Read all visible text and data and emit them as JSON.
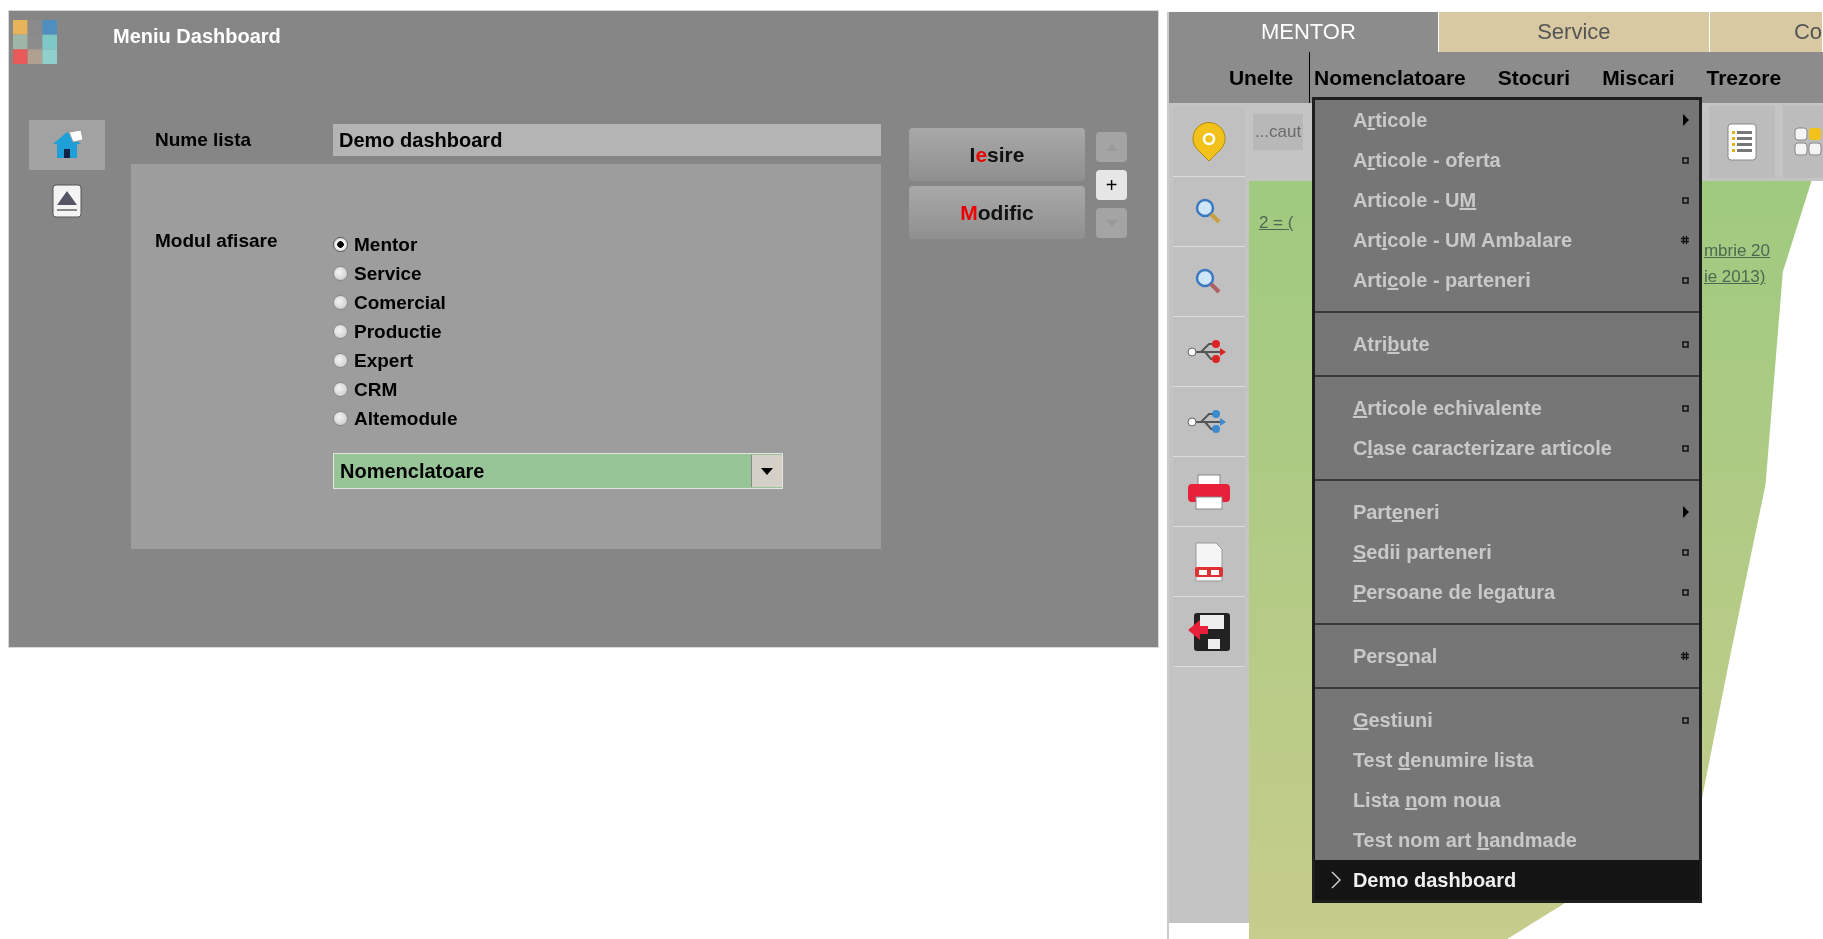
{
  "window": {
    "title": "Meniu Dashboard"
  },
  "sidebar": [
    {
      "kind": "home",
      "selected": true
    },
    {
      "kind": "edit",
      "selected": false
    }
  ],
  "form": {
    "name_label": "Nume lista",
    "name_value": "Demo dashboard",
    "mode_label": "Modul  afisare",
    "modes": [
      {
        "label": "Mentor",
        "selected": true
      },
      {
        "label": "Service",
        "selected": false
      },
      {
        "label": "Comercial",
        "selected": false
      },
      {
        "label": "Productie",
        "selected": false
      },
      {
        "label": "Expert",
        "selected": false
      },
      {
        "label": "CRM",
        "selected": false
      },
      {
        "label": "Altemodule",
        "selected": false
      }
    ],
    "dropdown_value": "Nomenclatoare"
  },
  "buttons": [
    {
      "before": "I",
      "hotkey": "e",
      "after": "sire"
    },
    {
      "hotkey": "M",
      "after": "odific"
    }
  ],
  "spinner": {
    "plus": "+"
  },
  "app": {
    "tabs": [
      {
        "label": "MENTOR",
        "selected": true
      },
      {
        "label": "Service",
        "selected": false
      },
      {
        "label": "Co",
        "selected": false
      }
    ],
    "menubar": [
      {
        "label": "Unelte",
        "open": false
      },
      {
        "label": "Nomenclatoare",
        "open": true
      },
      {
        "label": "Stocuri",
        "open": false
      },
      {
        "label": "Miscari",
        "open": false
      },
      {
        "label": "Trezore",
        "open": false
      }
    ],
    "search_placeholder": "...caut",
    "fragments": [
      "2 = (",
      "mbrie 20",
      "ie 2013)"
    ],
    "menu": {
      "sections": [
        {
          "items": [
            {
              "before": "A",
              "underlined": "r",
              "after": "ticole",
              "kind": "submenu",
              "selected": false
            },
            {
              "before": "A",
              "underlined": "r",
              "after": "ticole - oferta",
              "kind": "square",
              "selected": false
            },
            {
              "before": "Articole - U",
              "underlined": "M",
              "kind": "square",
              "selected": false
            },
            {
              "before": "Art",
              "underlined": "i",
              "after": "cole - UM Ambalare",
              "kind": "grid",
              "selected": false
            },
            {
              "before": "Arti",
              "underlined": "c",
              "after": "ole - parteneri",
              "kind": "square",
              "selected": false
            }
          ]
        },
        {
          "items": [
            {
              "before": "Atri",
              "underlined": "b",
              "after": "ute",
              "kind": "square",
              "selected": false
            }
          ]
        },
        {
          "items": [
            {
              "underlined": "A",
              "after": "rticole echivalente",
              "kind": "square",
              "selected": false
            },
            {
              "before": "C",
              "underlined": "l",
              "after": "ase caracterizare articole",
              "kind": "square",
              "selected": false
            }
          ]
        },
        {
          "items": [
            {
              "before": "Part",
              "underlined": "e",
              "after": "neri",
              "kind": "submenu",
              "selected": false
            },
            {
              "underlined": "S",
              "after": "edii parteneri",
              "kind": "square",
              "selected": false
            },
            {
              "underlined": "P",
              "after": "ersoane de legatura",
              "kind": "square",
              "selected": false
            }
          ]
        },
        {
          "items": [
            {
              "before": "Pers",
              "underlined": "o",
              "after": "nal",
              "kind": "grid",
              "selected": false
            }
          ]
        },
        {
          "items": [
            {
              "underlined": "G",
              "after": "estiuni",
              "kind": "square",
              "selected": false
            },
            {
              "before": "Test ",
              "underlined": "d",
              "after": "enumire lista",
              "kind": "plain",
              "selected": false
            },
            {
              "before": "Lista ",
              "underlined": "n",
              "after": "om noua",
              "kind": "plain",
              "selected": false
            },
            {
              "before": "Test nom art ",
              "underlined": "h",
              "after": "andmade",
              "kind": "plain",
              "selected": false
            },
            {
              "before": "Demo dashboard",
              "kind": "plain",
              "selected": true
            }
          ]
        }
      ]
    }
  }
}
